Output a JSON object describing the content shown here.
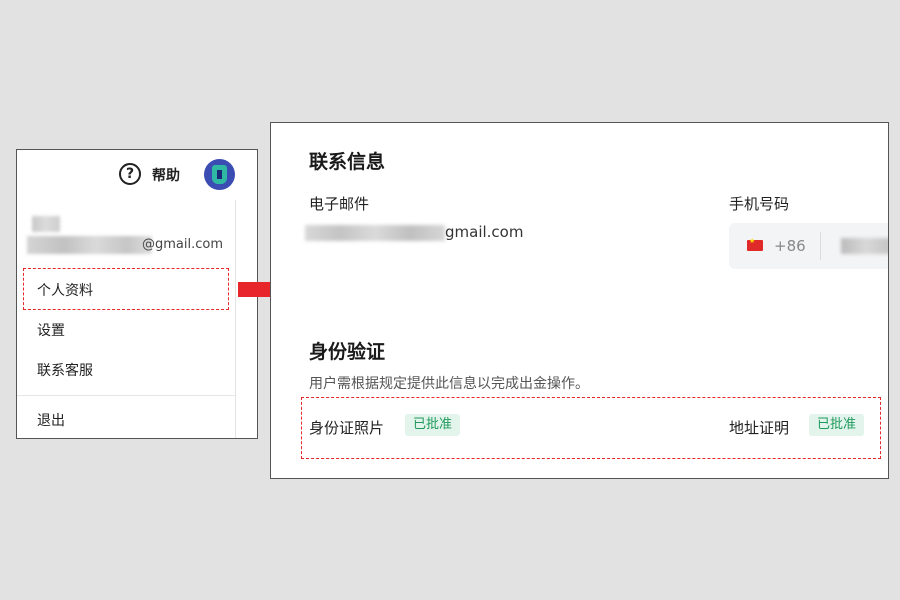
{
  "left_panel": {
    "help_label": "帮助",
    "help_icon_glyph": "?",
    "avatar_icon": "avatar-icon",
    "email_suffix": "@gmail.com",
    "menu": {
      "profile": "个人资料",
      "settings": "设置",
      "support": "联系客服",
      "logout": "退出"
    }
  },
  "right_panel": {
    "contact_title": "联系信息",
    "email_label": "电子邮件",
    "email_suffix": "gmail.com",
    "phone_label": "手机号码",
    "phone_code": "+86",
    "verify_title": "身份验证",
    "verify_desc": "用户需根据规定提供此信息以完成出金操作。",
    "id_photo_label": "身份证照片",
    "id_photo_status": "已批准",
    "address_label": "地址证明",
    "address_status": "已批准"
  },
  "colors": {
    "highlight": "#e8252a",
    "approved_badge_bg": "#e3f4ec",
    "approved_badge_text": "#1f9a5c",
    "arrow": "#e8252a"
  }
}
